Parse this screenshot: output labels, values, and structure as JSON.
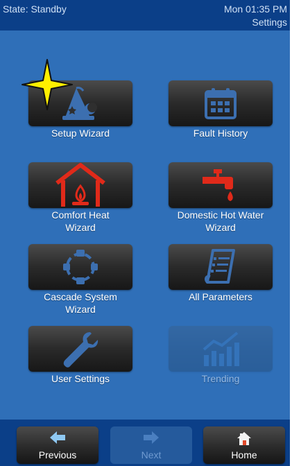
{
  "header": {
    "state": "State: Standby",
    "clock": "Mon 01:35 PM",
    "screen": "Settings"
  },
  "tiles": [
    {
      "id": "setup-wizard",
      "label": "Setup Wizard",
      "icon": "wizard-hat-icon",
      "enabled": true
    },
    {
      "id": "fault-history",
      "label": "Fault History",
      "icon": "calendar-icon",
      "enabled": true
    },
    {
      "id": "comfort-heat",
      "label": "Comfort Heat\nWizard",
      "icon": "house-flame-icon",
      "enabled": true
    },
    {
      "id": "domestic-hot-water",
      "label": "Domestic Hot Water\nWizard",
      "icon": "faucet-icon",
      "enabled": true
    },
    {
      "id": "cascade-system",
      "label": "Cascade System\nWizard",
      "icon": "cascade-ring-icon",
      "enabled": true
    },
    {
      "id": "all-parameters",
      "label": "All Parameters",
      "icon": "document-list-icon",
      "enabled": true
    },
    {
      "id": "user-settings",
      "label": "User Settings",
      "icon": "wrench-icon",
      "enabled": true
    },
    {
      "id": "trending",
      "label": "Trending",
      "icon": "trend-chart-icon",
      "enabled": false
    }
  ],
  "footer": {
    "previous": "Previous",
    "next": "Next",
    "home": "Home"
  },
  "colors": {
    "background": "#2f6fb8",
    "bar": "#0b3f88",
    "accent_red": "#e02a1a",
    "icon_blue": "#3c6fb0",
    "sparkle": "#ffef00"
  }
}
